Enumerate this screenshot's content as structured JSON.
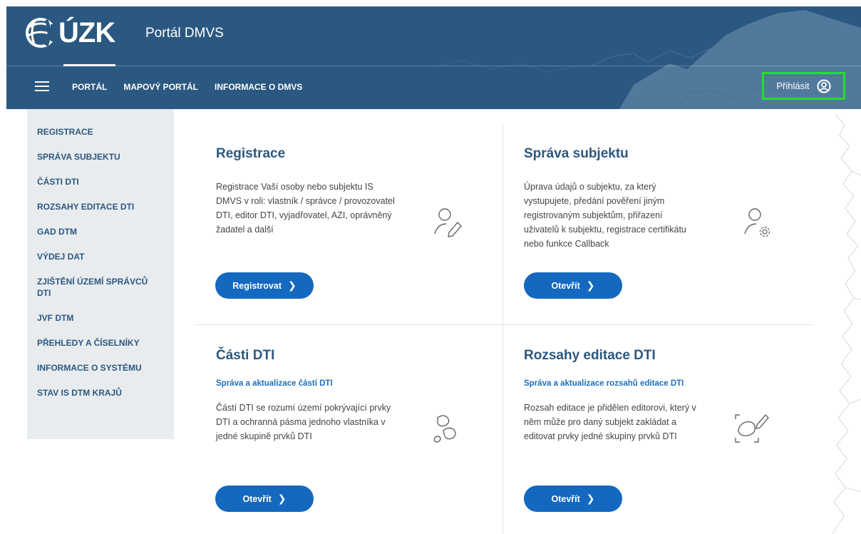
{
  "header": {
    "logo_text": "ÚZK",
    "portal_title": "Portál DMVS",
    "nav": [
      "PORTÁL",
      "MAPOVÝ PORTÁL",
      "INFORMACE O DMVS"
    ],
    "login_label": "Přihlásit",
    "colors": {
      "header_bg": "#2b5880",
      "accent": "#1468bf",
      "login_highlight": "#22e02a"
    }
  },
  "sidebar": {
    "items": [
      "REGISTRACE",
      "SPRÁVA SUBJEKTU",
      "ČÁSTI DTI",
      "ROZSAHY EDITACE DTI",
      "GAD DTM",
      "VÝDEJ DAT",
      "ZJIŠTĚNÍ ÚZEMÍ SPRÁVCŮ DTI",
      "JVF DTM",
      "PŘEHLEDY A ČÍSELNÍKY",
      "INFORMACE O SYSTÉMU",
      "STAV IS DTM KRAJŮ"
    ]
  },
  "cards": {
    "registrace": {
      "title": "Registrace",
      "desc": "Registrace Vaší osoby nebo subjektu IS DMVS v roli: vlastník / správce / provozovatel DTI, editor DTI, vyjadřovatel, AZI, oprávněný žadatel a další",
      "button": "Registrovat",
      "icon": "user-edit-icon"
    },
    "sprava": {
      "title": "Správa subjektu",
      "desc": "Úprava údajů o subjektu, za který vystupujete, předání pověření jiným registrovaným subjektům, přiřazení uživatelů k subjektu, registrace certifikátu nebo funkce Callback",
      "button": "Otevřít",
      "icon": "user-settings-icon"
    },
    "casti": {
      "title": "Části DTI",
      "subtitle": "Správa a aktualizace částí DTI",
      "desc": "Částí DTI se rozumí území pokrývající prvky DTI a ochranná pásma jednoho vlastníka v jedné skupině prvků DTI",
      "button": "Otevřít",
      "icon": "areas-icon"
    },
    "rozsahy": {
      "title": "Rozsahy editace DTI",
      "subtitle": "Správa a aktualizace rozsahů editace DTI",
      "desc": "Rozsah editace je přidělen editorovi, který v něm může pro daný subjekt zakládat a editovat prvky jedné skupiny prvků DTI",
      "button": "Otevřít",
      "icon": "area-edit-icon"
    }
  }
}
